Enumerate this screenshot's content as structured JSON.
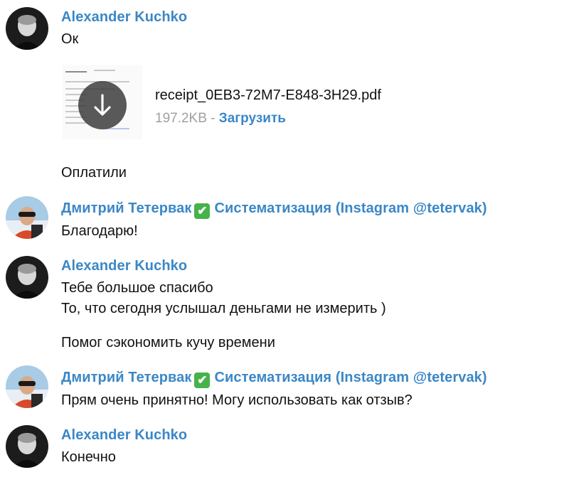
{
  "messages": [
    {
      "sender": "Alexander Kuchko",
      "lines": [
        "Ок"
      ]
    },
    {
      "file": {
        "name": "receipt_0EB3-72M7-E848-3H29.pdf",
        "size": "197.2KB",
        "separator": " - ",
        "download_label": "Загрузить"
      }
    },
    {
      "lines": [
        "Оплатили"
      ]
    },
    {
      "sender": "Дмитрий Тетервак",
      "badge": "✔",
      "sender_suffix": "Систематизация (Instagram @tetervak)",
      "lines": [
        "Благодарю!"
      ]
    },
    {
      "sender": "Alexander Kuchko",
      "lines": [
        "Тебе большое спасибо",
        "То, что сегодня услышал деньгами не измерить )",
        "Помог сэкономить кучу времени"
      ]
    },
    {
      "sender": "Дмитрий Тетервак",
      "badge": "✔",
      "sender_suffix": "Систематизация (Instagram @tetervak)",
      "lines": [
        "Прям очень принятно! Могу использовать как отзыв?"
      ]
    },
    {
      "sender": "Alexander Kuchko",
      "lines": [
        "Конечно"
      ]
    }
  ],
  "colors": {
    "sender": "#3a87c7",
    "check_badge": "#46b24a"
  },
  "icons": {
    "download": "arrow-down-icon",
    "verified": "check-mark-icon"
  }
}
